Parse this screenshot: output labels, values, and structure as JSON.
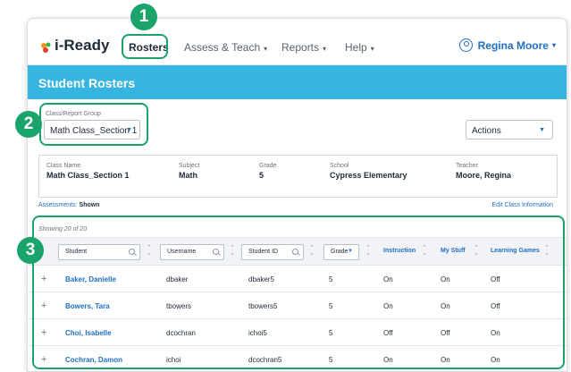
{
  "topnav": {
    "logo": "i-Ready",
    "items": [
      {
        "label": "Rosters",
        "caret": ""
      },
      {
        "label": "Assess & Teach",
        "caret": "▾"
      },
      {
        "label": "Reports",
        "caret": "▾"
      },
      {
        "label": "Help",
        "caret": "▾"
      }
    ],
    "user": "Regina Moore",
    "user_caret": "▾"
  },
  "banner": {
    "title": "Student Rosters"
  },
  "group": {
    "label": "Class/Report Group",
    "selected": "Math Class_Section 1"
  },
  "actions": {
    "label": "Actions"
  },
  "class_info": {
    "class_name_label": "Class Name",
    "class_name": "Math Class_Section 1",
    "subject_label": "Subject",
    "subject": "Math",
    "grade_label": "Grade",
    "grade": "5",
    "school_label": "School",
    "school": "Cypress Elementary",
    "teacher_label": "Teacher",
    "teacher": "Moore, Regina"
  },
  "assessments": {
    "label": "Assessments:",
    "value": "Shown"
  },
  "edit_link": "Edit Class Information",
  "showing": "Showing 20 of 20",
  "columns": {
    "student": "Student",
    "username": "Username",
    "student_id": "Student ID",
    "grade": "Grade",
    "instruction": "Instruction",
    "my_stuff": "My Stuff",
    "learning_games": "Learning Games"
  },
  "rows": [
    {
      "name": "Baker, Danielle",
      "username": "dbaker",
      "student_id": "dbaker5",
      "grade": "5",
      "instruction": "On",
      "my_stuff": "On",
      "learning_games": "Off"
    },
    {
      "name": "Bowers, Tara",
      "username": "tbowers",
      "student_id": "tbowers5",
      "grade": "5",
      "instruction": "On",
      "my_stuff": "On",
      "learning_games": "Off"
    },
    {
      "name": "Choi, Isabelle",
      "username": "dcochran",
      "student_id": "ichoi5",
      "grade": "5",
      "instruction": "Off",
      "my_stuff": "Off",
      "learning_games": "On"
    },
    {
      "name": "Cochran, Damon",
      "username": "ichoi",
      "student_id": "dcochran5",
      "grade": "5",
      "instruction": "On",
      "my_stuff": "On",
      "learning_games": "On"
    }
  ],
  "callouts": [
    "1",
    "2",
    "3"
  ],
  "colors": {
    "accent": "#1aa36a",
    "banner": "#36b5e0",
    "link": "#1f6fc2"
  }
}
